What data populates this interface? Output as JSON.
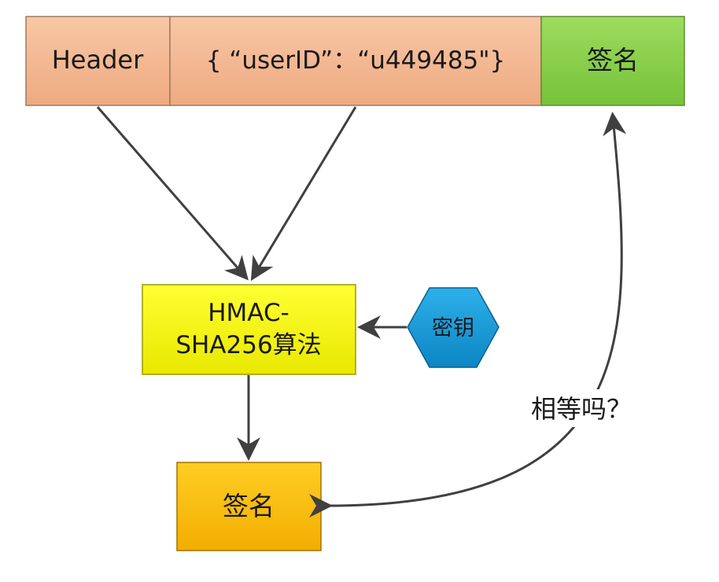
{
  "token": {
    "header_label": "Header",
    "payload_label": "{ “userID”：“u449485\"}",
    "signature_label": "签名"
  },
  "algorithm": {
    "line1": "HMAC-",
    "line2": "SHA256算法"
  },
  "secret_key": {
    "label": "密钥"
  },
  "computed_signature": {
    "label": "签名"
  },
  "compare": {
    "label": "相等吗？"
  },
  "colors": {
    "header_fill": "#f4b68f",
    "signature_fill": "#8fd14f",
    "algorithm_fill": "#ffff00",
    "key_fill": "#1a9ad6",
    "computed_fill": "#ffc000",
    "arrow": "#404040"
  }
}
